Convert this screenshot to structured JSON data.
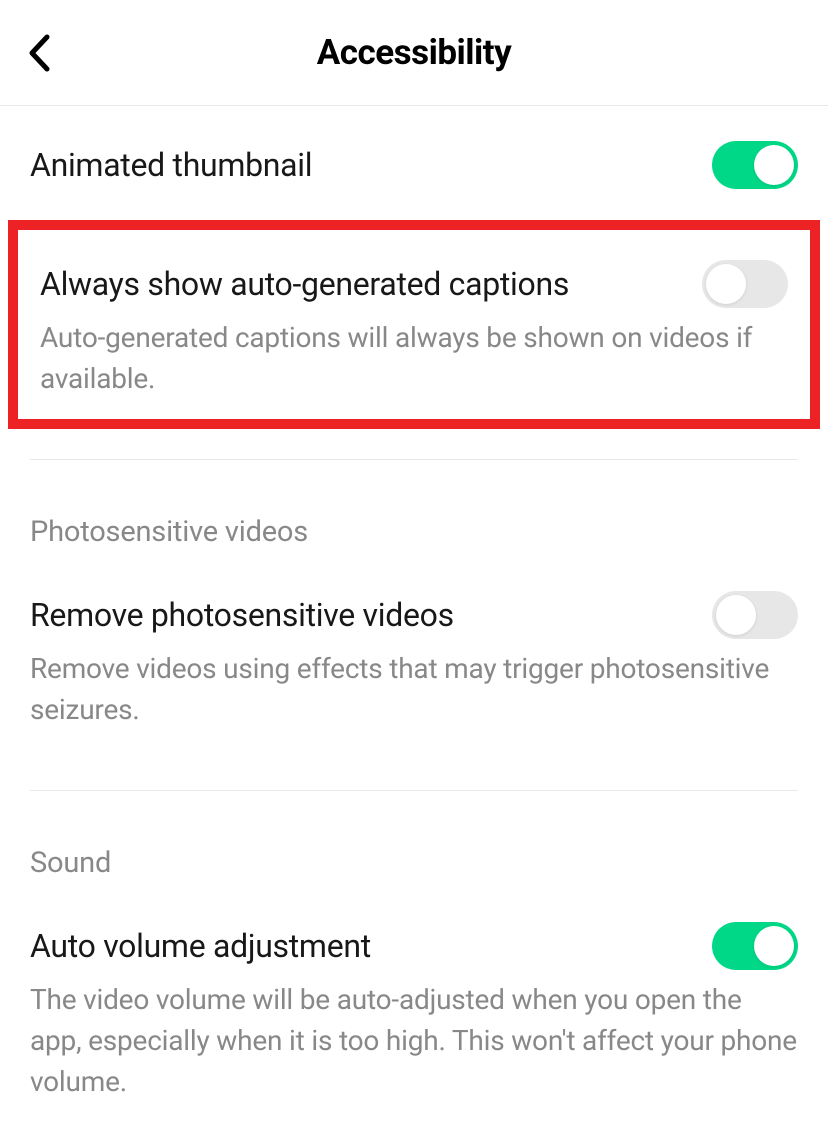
{
  "header": {
    "title": "Accessibility"
  },
  "settings": {
    "animated_thumbnail": {
      "label": "Animated thumbnail",
      "enabled": true
    },
    "auto_captions": {
      "label": "Always show auto-generated captions",
      "description": "Auto-generated captions will always be shown on videos if available.",
      "enabled": false
    },
    "photosensitive": {
      "section_title": "Photosensitive videos",
      "label": "Remove photosensitive videos",
      "description": "Remove videos using effects that may trigger photosensitive seizures.",
      "enabled": false
    },
    "sound": {
      "section_title": "Sound",
      "label": "Auto volume adjustment",
      "description": "The video volume will be auto-adjusted when you open the app, especially when it is too high. This won't affect your phone volume.",
      "enabled": true
    }
  }
}
